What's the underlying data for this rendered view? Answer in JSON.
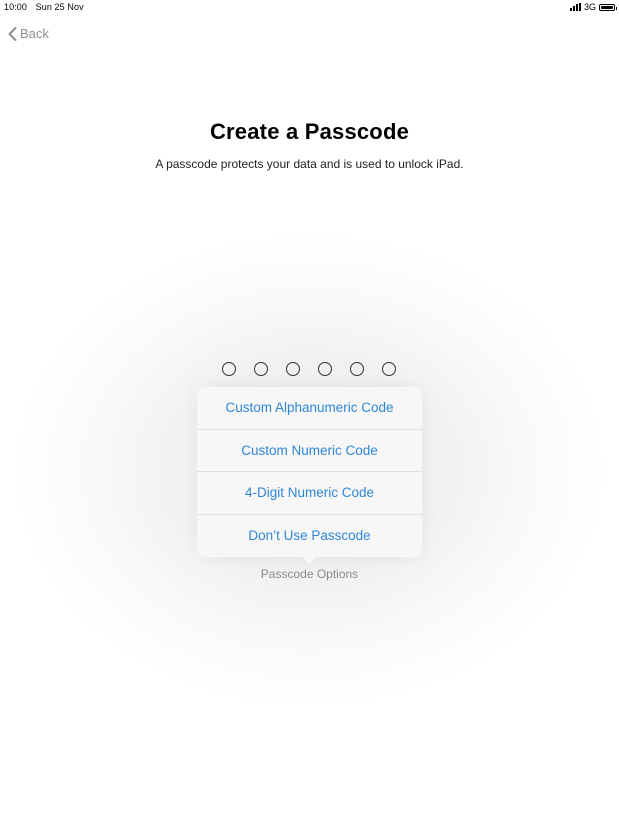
{
  "status_bar": {
    "time": "10:00",
    "date": "Sun 25 Nov",
    "network": "3G",
    "signal_icon": "signal-bars-icon",
    "battery_icon": "battery-icon"
  },
  "nav": {
    "back_label": "Back",
    "back_icon": "chevron-left-icon"
  },
  "header": {
    "title": "Create a Passcode",
    "subtitle": "A passcode protects your data and is used to unlock iPad."
  },
  "passcode": {
    "digit_count": 6,
    "filled": 0
  },
  "popover": {
    "options": [
      {
        "label": "Custom Alphanumeric Code"
      },
      {
        "label": "Custom Numeric Code"
      },
      {
        "label": "4-Digit Numeric Code"
      },
      {
        "label": "Don’t Use Passcode"
      }
    ],
    "caption": "Passcode Options"
  },
  "colors": {
    "accent": "#2f86d6",
    "back_gray": "#8e8e93",
    "caption_gray": "#8a8a8a",
    "popover_bg": "#f7f7f7"
  }
}
